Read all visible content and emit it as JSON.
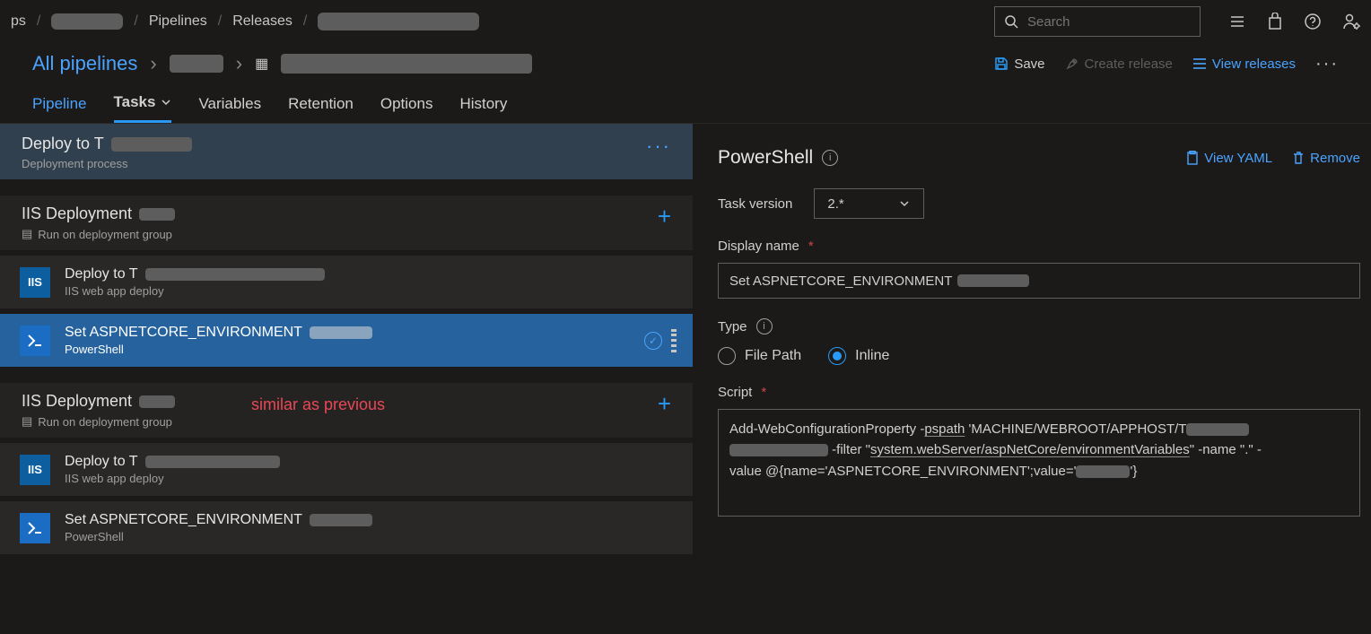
{
  "breadcrumbs": {
    "item1": "Pipelines",
    "item2": "Releases"
  },
  "search": {
    "placeholder": "Search"
  },
  "title": {
    "all": "All pipelines"
  },
  "toolbar": {
    "save": "Save",
    "create": "Create release",
    "view": "View releases"
  },
  "tabs": {
    "pipeline": "Pipeline",
    "tasks": "Tasks",
    "variables": "Variables",
    "retention": "Retention",
    "options": "Options",
    "history": "History"
  },
  "stage": {
    "title": "Deploy to T",
    "sub": "Deployment process"
  },
  "group": {
    "title1": "IIS Deployment",
    "sub1": "Run on deployment group",
    "task1_title": "Deploy to T",
    "task1_sub": "IIS web app deploy",
    "task2_title": "Set ASPNETCORE_ENVIRONMENT",
    "task2_sub": "PowerShell",
    "title2": "IIS Deployment",
    "sub2": "Run on deployment group",
    "task3_title": "Deploy to T",
    "task3_sub": "IIS web app deploy",
    "task4_title": "Set ASPNETCORE_ENVIRONMENT",
    "task4_sub": "PowerShell",
    "annotation": "similar as previous"
  },
  "panel": {
    "header": "PowerShell",
    "view_yaml": "View YAML",
    "remove": "Remove",
    "task_version_label": "Task version",
    "task_version_value": "2.*",
    "display_name_label": "Display name",
    "display_name_value": "Set ASPNETCORE_ENVIRONMENT",
    "type_label": "Type",
    "type_filepath": "File Path",
    "type_inline": "Inline",
    "script_label": "Script",
    "script_l1a": "Add-WebConfigurationProperty -",
    "script_l1b": "pspath",
    "script_l1c": " 'MACHINE/WEBROOT/APPHOST/T",
    "script_l2a": " -filter \"",
    "script_l2b": "system.webServer/aspNetCore/environmentVariables",
    "script_l2c": "\" -name \".\" -",
    "script_l3a": "value @{name='ASPNETCORE_ENVIRONMENT';value='",
    "script_l3b": "'}"
  }
}
